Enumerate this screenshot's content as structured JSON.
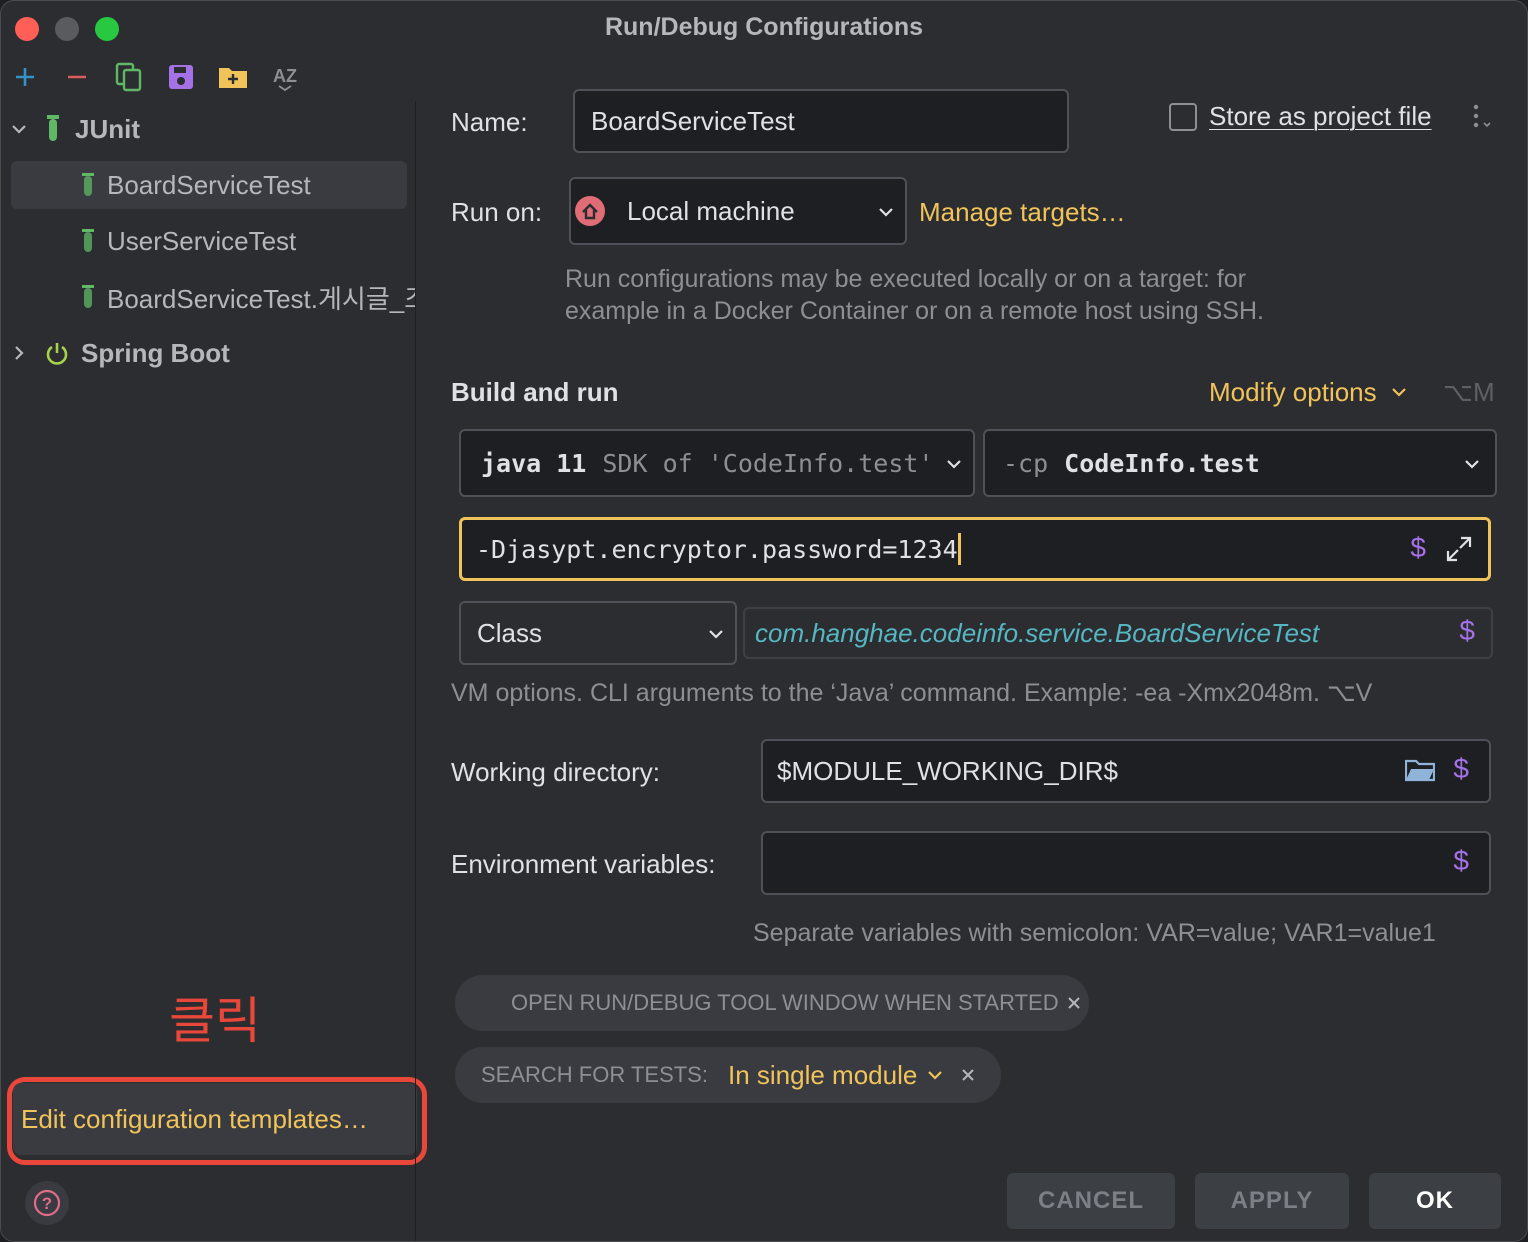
{
  "window": {
    "title": "Run/Debug Configurations"
  },
  "toolbar": {
    "items": [
      {
        "icon": "add-icon",
        "color": "#3592c4"
      },
      {
        "icon": "remove-icon",
        "color": "#db5c5c"
      },
      {
        "icon": "copy-icon",
        "color": "#5fb865"
      },
      {
        "icon": "save-icon",
        "color": "#a571e6"
      },
      {
        "icon": "new-folder-icon",
        "color": "#f0c35b"
      },
      {
        "icon": "sort-alpha-icon",
        "color": "#8c8f94"
      }
    ]
  },
  "sidebar": {
    "groups": [
      {
        "label": "JUnit",
        "expanded": true,
        "icon": "junit-icon"
      },
      {
        "label": "Spring Boot",
        "expanded": false,
        "icon": "spring-boot-icon"
      }
    ],
    "items": [
      {
        "label": "BoardServiceTest",
        "selected": true
      },
      {
        "label": "UserServiceTest",
        "selected": false
      },
      {
        "label": "BoardServiceTest.게시글_조",
        "selected": false
      }
    ],
    "annotation": "클릭",
    "edit_templates": "Edit configuration templates…"
  },
  "form": {
    "name_label": "Name:",
    "name_value": "BoardServiceTest",
    "store_label": "Store as project file",
    "store_checked": false,
    "run_on_label": "Run on:",
    "run_on_value": "Local machine",
    "manage_targets": "Manage targets…",
    "run_on_hint_1": "Run configurations may be executed locally or on a target: for",
    "run_on_hint_2": "example in a Docker Container or on a remote host using SSH.",
    "section_title": "Build and run",
    "modify_options": "Modify options",
    "modify_shortcut": "⌥M",
    "sdk_main": "java 11",
    "sdk_sub": "SDK of 'CodeInfo.test'",
    "cp_prefix": "-cp",
    "cp_value": "CodeInfo.test",
    "vm_options_value": "-Djasypt.encryptor.password=1234",
    "test_kind": "Class",
    "class_value": "com.hanghae.codeinfo.service.BoardServiceTest",
    "vm_hint": "VM options. CLI arguments to the ‘Java’ command. Example: -ea -Xmx2048m. ⌥V",
    "workdir_label": "Working directory:",
    "workdir_value": "$MODULE_WORKING_DIR$",
    "env_label": "Environment variables:",
    "env_value": "",
    "env_hint": "Separate variables with semicolon: VAR=value; VAR1=value1",
    "chip_open_tool": "OPEN RUN/DEBUG TOOL WINDOW WHEN STARTED",
    "chip_search_label": "SEARCH FOR TESTS:",
    "chip_search_value": "In single module",
    "dollar": "$"
  },
  "buttons": {
    "cancel": "CANCEL",
    "apply": "APPLY",
    "ok": "OK"
  },
  "colors": {
    "accent": "#f0c35b",
    "annotation": "#e8473a",
    "macro": "#a571e6",
    "class_text": "#56b6c2"
  }
}
